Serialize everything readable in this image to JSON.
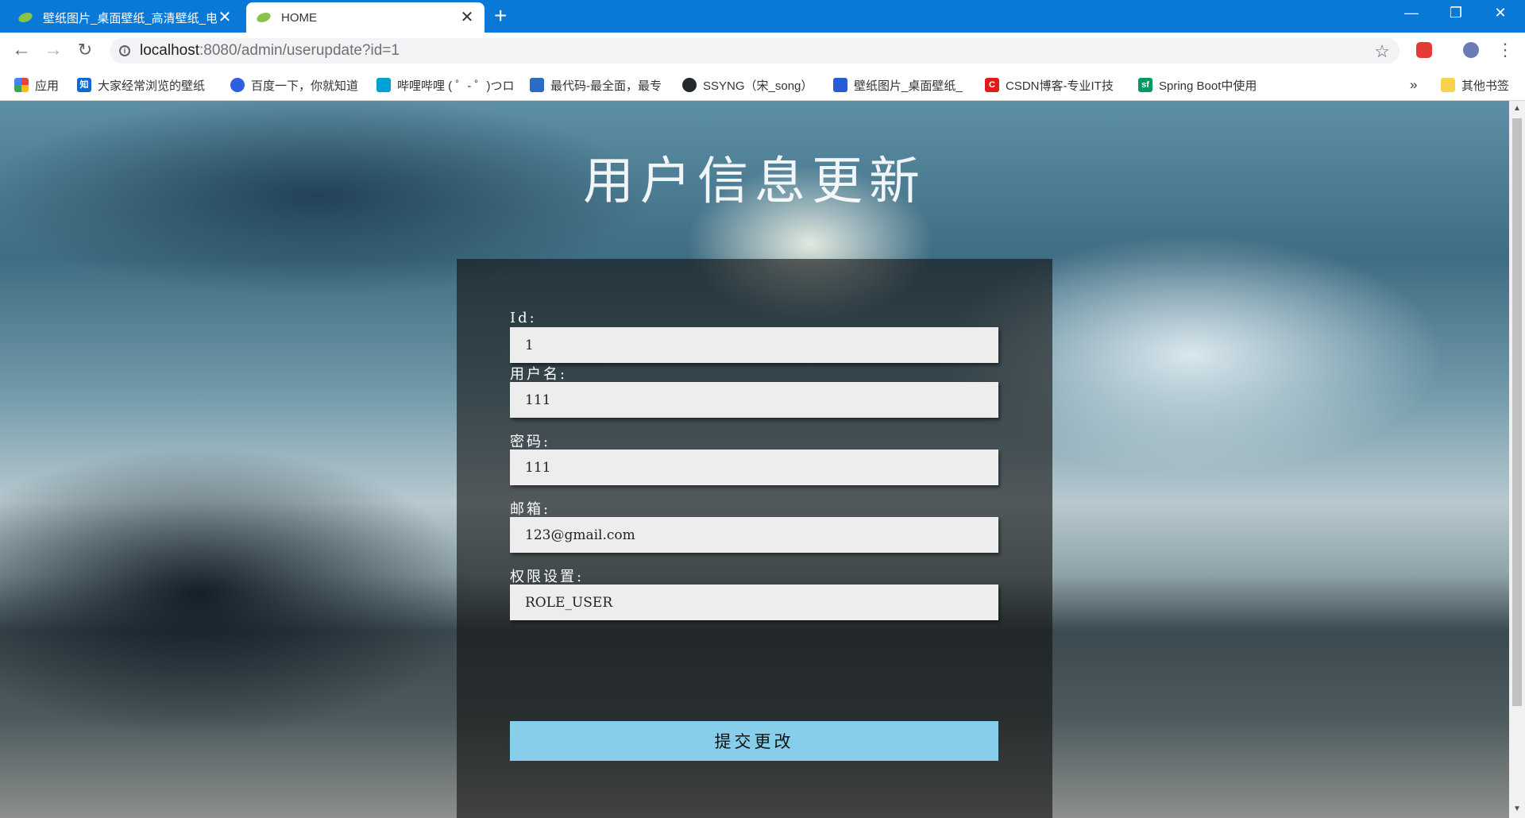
{
  "tabs": [
    {
      "title": "壁纸图片_桌面壁纸_高清壁纸_电",
      "close": "✕"
    },
    {
      "title": "HOME",
      "close": "✕"
    }
  ],
  "new_tab": "+",
  "window_controls": {
    "minimize": "—",
    "maximize": "❐",
    "close": "✕"
  },
  "address_bar": {
    "url_host": "localhost",
    "url_rest": ":8080/admin/userupdate?id=1"
  },
  "bookmarks": [
    {
      "label": "应用",
      "icon": "apps-grid-icon"
    },
    {
      "label": "大家经常浏览的壁纸",
      "icon": "zhihu-icon"
    },
    {
      "label": "百度一下，你就知道",
      "icon": "baidu-paw-icon"
    },
    {
      "label": "哔哩哔哩 ( ゜- ゜)つロ",
      "icon": "bilibili-icon"
    },
    {
      "label": "最代码-最全面，最专",
      "icon": "zuidaima-icon"
    },
    {
      "label": "SSYNG（宋_song）",
      "icon": "github-icon"
    },
    {
      "label": "壁纸图片_桌面壁纸_",
      "icon": "wallpaper-site-icon"
    },
    {
      "label": "CSDN博客-专业IT技",
      "icon": "csdn-icon"
    },
    {
      "label": "Spring Boot中使用",
      "icon": "segmentfault-icon"
    }
  ],
  "bookmarks_overflow": "»",
  "other_bookmarks": "其他书签",
  "page": {
    "heading": "用户信息更新",
    "fields": {
      "id_label": "Id:",
      "id_value": "1",
      "username_label": "用户名:",
      "username_value": "111",
      "password_label": "密码:",
      "password_value": "111",
      "email_label": "邮箱:",
      "email_value": "123@gmail.com",
      "role_label": "权限设置:",
      "role_value": "ROLE_USER"
    },
    "submit_label": "提交更改"
  },
  "colors": {
    "tab_strip": "#0a78d7",
    "submit_button": "#87ceeb",
    "panel": "rgba(20,20,20,0.62)"
  }
}
